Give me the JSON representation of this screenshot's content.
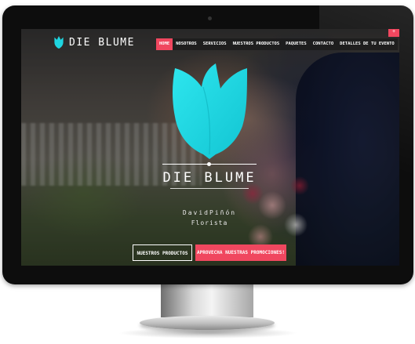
{
  "site": {
    "brand": "DIE BLUME",
    "accent_color": "#f0475f",
    "logo_color": "#1fd5e0"
  },
  "nav": {
    "items": [
      "HOME",
      "NOSOTROS",
      "SERVICIOS",
      "NUESTROS PRODUCTOS",
      "PAQUETES",
      "CONTACTO",
      "DETALLES DE TU EVENTO"
    ],
    "active": "HOME"
  },
  "hero": {
    "title": "DIE BLUME",
    "name": "DavidPiñón",
    "role": "Florista"
  },
  "buttons": {
    "products": "NUESTROS PRODUCTOS",
    "promotions": "APROVECHA NUESTRAS PROMOCIONES!"
  },
  "corner_tab": "+"
}
